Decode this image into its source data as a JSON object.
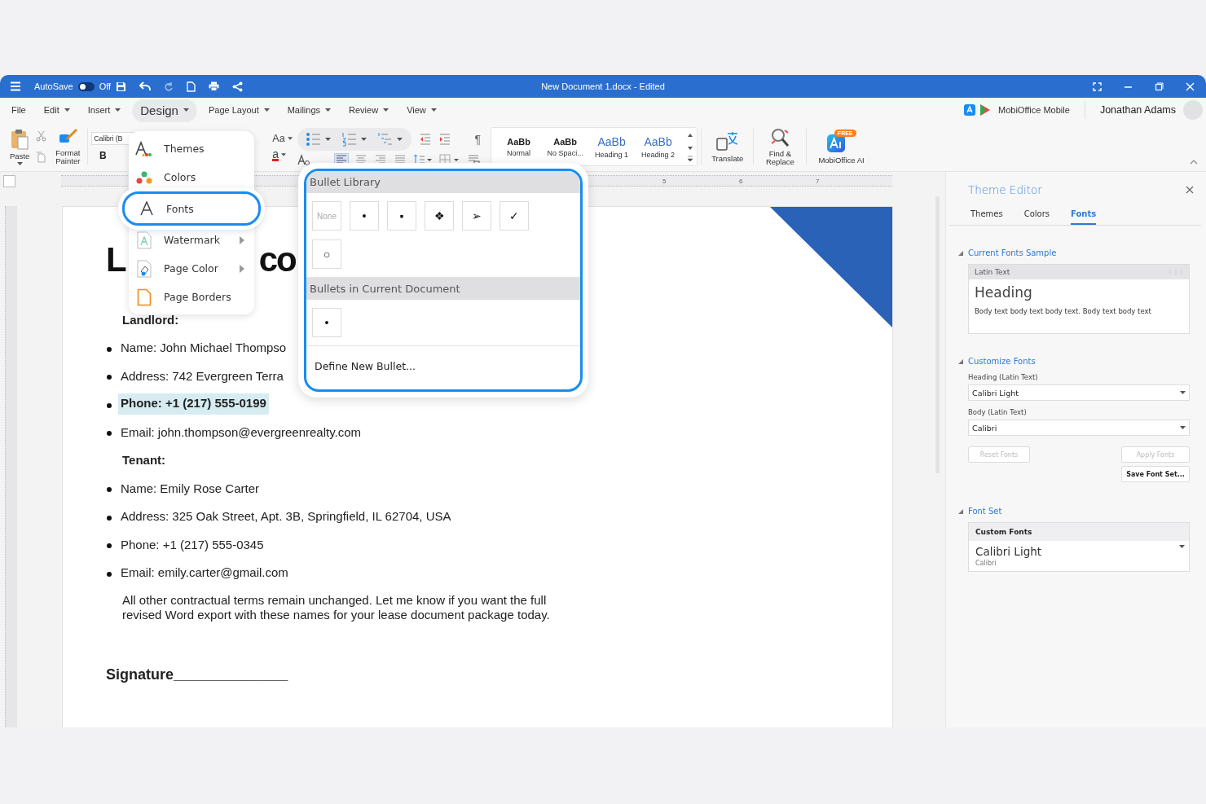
{
  "titlebar": {
    "autosave_label": "AutoSave",
    "autosave_on": false,
    "autosave_state": "Off",
    "title": "New Document 1.docx - Edited"
  },
  "menu": [
    {
      "label": "File",
      "dropdown": false,
      "selected": false
    },
    {
      "label": "Edit",
      "dropdown": true,
      "selected": false
    },
    {
      "label": "Insert",
      "dropdown": true,
      "selected": false
    },
    {
      "label": "Design",
      "dropdown": true,
      "selected": true
    },
    {
      "label": "Page Layout",
      "dropdown": true,
      "selected": false
    },
    {
      "label": "Mailings",
      "dropdown": true,
      "selected": false
    },
    {
      "label": "Review",
      "dropdown": true,
      "selected": false
    },
    {
      "label": "View",
      "dropdown": true,
      "selected": false
    }
  ],
  "account": {
    "mobile_label": "MobiOffice Mobile",
    "user": "Jonathan Adams"
  },
  "ribbon": {
    "paste": "Paste",
    "format_painter": "Format Painter",
    "font_name": "Calibri (B",
    "bold": "B",
    "change_case": "Aa",
    "font_color": "a",
    "pilcrow": "¶",
    "styles": [
      {
        "sample": "AaBb",
        "name": "Normal",
        "kind": "body"
      },
      {
        "sample": "AaBb",
        "name": "No Spaci...",
        "kind": "body"
      },
      {
        "sample": "AaBb",
        "name": "Heading 1",
        "kind": "heading"
      },
      {
        "sample": "AaBb",
        "name": "Heading 2",
        "kind": "heading"
      }
    ],
    "translate": "Translate",
    "find_replace": "Find & Replace",
    "ai": "MobiOffice AI",
    "ai_badge": "FREE"
  },
  "ruler": {
    "numbers": [
      "5",
      "6",
      "7"
    ]
  },
  "document": {
    "title_fragments": [
      "L",
      "co"
    ],
    "blocks": [
      {
        "kind": "label",
        "text": "Landlord:",
        "highlighted": false
      },
      {
        "kind": "bullet",
        "text": "Name: John Michael Thompso",
        "highlighted": false
      },
      {
        "kind": "bullet",
        "text": "Address: 742 Evergreen Terra",
        "highlighted": false
      },
      {
        "kind": "bullet",
        "text": "Phone: +1 (217) 555-0199",
        "highlighted": true
      },
      {
        "kind": "bullet",
        "text": "Email: john.thompson@evergreenrealty.com",
        "highlighted": false
      },
      {
        "kind": "label",
        "text": "Tenant:",
        "highlighted": false
      },
      {
        "kind": "bullet",
        "text": "Name: Emily Rose Carter",
        "highlighted": false
      },
      {
        "kind": "bullet",
        "text": "Address: 325 Oak Street, Apt. 3B, Springfield, IL 62704, USA",
        "highlighted": false
      },
      {
        "kind": "bullet",
        "text": "Phone: +1 (217) 555-0345",
        "highlighted": false
      },
      {
        "kind": "bullet",
        "text": "Email: emily.carter@gmail.com",
        "highlighted": false
      },
      {
        "kind": "paragraph",
        "text": "All other contractual terms remain unchanged. Let me know if you want the full revised Word export with these names for your lease document package today.",
        "highlighted": false
      },
      {
        "kind": "signature",
        "text": "Signature______________",
        "highlighted": false
      }
    ]
  },
  "design_menu": [
    {
      "label": "Themes",
      "kind": "themes",
      "submenu": false,
      "selected": false
    },
    {
      "label": "Colors",
      "kind": "colors",
      "submenu": false,
      "selected": false
    },
    {
      "label": "Fonts",
      "kind": "fonts",
      "submenu": false,
      "selected": true
    },
    {
      "label": "Watermark",
      "kind": "watermark",
      "submenu": true,
      "selected": false
    },
    {
      "label": "Page Color",
      "kind": "page-color",
      "submenu": true,
      "selected": false
    },
    {
      "label": "Page Borders",
      "kind": "page-borders",
      "submenu": false,
      "selected": false
    }
  ],
  "bullet_popup": {
    "sections": [
      {
        "title": "Bullet Library",
        "bullets": [
          "None",
          "•",
          "▪",
          "❖",
          "➢",
          "✓",
          "○"
        ]
      },
      {
        "title": "Bullets in Current Document",
        "bullets": [
          "•"
        ]
      }
    ],
    "define": "Define New Bullet..."
  },
  "theme_editor": {
    "title": "Theme Editor",
    "tabs": [
      {
        "label": "Themes",
        "selected": false
      },
      {
        "label": "Colors",
        "selected": false
      },
      {
        "label": "Fonts",
        "selected": true
      }
    ],
    "sample": {
      "heading": "Current Fonts Sample",
      "label": "Latin Text",
      "title": "Heading",
      "body": "Body text body text body text. Body text body text"
    },
    "customize": {
      "heading": "Customize Fonts",
      "fields": [
        {
          "label": "Heading (Latin Text)",
          "value": "Calibri Light"
        },
        {
          "label": "Body (Latin Text)",
          "value": "Calibri"
        }
      ],
      "buttons": [
        {
          "label": "Reset Fonts",
          "disabled": true
        },
        {
          "label": "Apply Fonts",
          "disabled": true
        },
        {
          "label": "Save Font Set...",
          "disabled": false
        }
      ]
    },
    "font_set": {
      "heading": "Font Set",
      "label": "Custom Fonts",
      "heading_font": "Calibri Light",
      "body_font": "Calibri"
    }
  }
}
